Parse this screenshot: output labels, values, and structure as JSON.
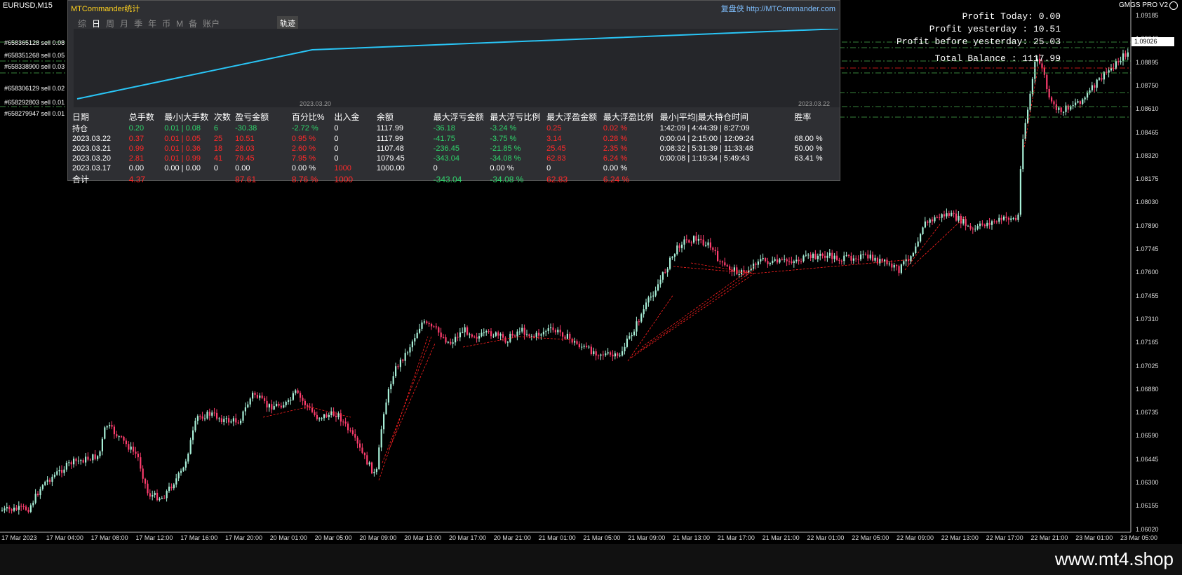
{
  "chart": {
    "symbol": "EURUSD,M15",
    "indicator_name": "GMGS PRO V2",
    "current_price": "1.09026",
    "price_ticks": [
      "1.09185",
      "1.09040",
      "1.08895",
      "1.08750",
      "1.08610",
      "1.08465",
      "1.08320",
      "1.08175",
      "1.08030",
      "1.07890",
      "1.07745",
      "1.07600",
      "1.07455",
      "1.07310",
      "1.07165",
      "1.07025",
      "1.06880",
      "1.06735",
      "1.06590",
      "1.06445",
      "1.06300",
      "1.06155",
      "1.06020"
    ],
    "time_ticks": [
      "17 Mar 2023",
      "17 Mar 04:00",
      "17 Mar 08:00",
      "17 Mar 12:00",
      "17 Mar 16:00",
      "17 Mar 20:00",
      "20 Mar 01:00",
      "20 Mar 05:00",
      "20 Mar 09:00",
      "20 Mar 13:00",
      "20 Mar 17:00",
      "20 Mar 21:00",
      "21 Mar 01:00",
      "21 Mar 05:00",
      "21 Mar 09:00",
      "21 Mar 13:00",
      "21 Mar 17:00",
      "21 Mar 21:00",
      "22 Mar 01:00",
      "22 Mar 05:00",
      "22 Mar 09:00",
      "22 Mar 13:00",
      "22 Mar 17:00",
      "22 Mar 21:00",
      "23 Mar 01:00",
      "23 Mar 05:00"
    ],
    "orders": [
      "#658365128 sell 0.08",
      "#658351268 sell 0.05",
      "#658338900 sell 0.03",
      "#658306129 sell 0.02",
      "#658292803 sell 0.01",
      "#658279947 sell 0.01"
    ],
    "profit": {
      "today": "Profit Today: 0.00",
      "yesterday": "Profit yesterday : 10.51",
      "before_yesterday": "Profit before yesterday: 25.03",
      "balance": "Total Balance : 1117.99"
    },
    "colors": {
      "bull": "#a8f0d8",
      "bear": "#ff3d6e",
      "grid_green": "#4caf50",
      "order_line": "#ff2020",
      "equity": "#29c5f6"
    }
  },
  "panel": {
    "title": "MTCommander统计",
    "site": "复盘侠 http://MTCommander.com",
    "tabs": [
      "综",
      "日",
      "周",
      "月",
      "季",
      "年",
      "币",
      "M",
      "备",
      "账户"
    ],
    "active_tab": "日",
    "track_button": "轨迹",
    "graph_date_left": "2023.03.20",
    "graph_date_right": "2023.03.22",
    "headers": [
      "日期",
      "总手数",
      "最小|大手数",
      "次数",
      "盈亏金额",
      "百分比%",
      "出入金",
      "余额",
      "最大浮亏金额",
      "最大浮亏比例",
      "最大浮盈金额",
      "最大浮盈比例",
      "最小|平均|最大持仓时间",
      "胜率"
    ],
    "rows": [
      [
        "持仓",
        "0.20",
        "0.01 | 0.08",
        "6",
        "-30.38",
        "-2.72 %",
        "0",
        "1117.99",
        "-36.18",
        "-3.24 %",
        "0.25",
        "0.02 %",
        "1:42:09 | 4:44:39 | 8:27:09",
        ""
      ],
      [
        "2023.03.22",
        "0.37",
        "0.01 | 0.05",
        "25",
        "10.51",
        "0.95 %",
        "0",
        "1117.99",
        "-41.75",
        "-3.75 %",
        "3.14",
        "0.28 %",
        "0:00:04 | 2:15:00 | 12:09:24",
        "68.00 %"
      ],
      [
        "2023.03.21",
        "0.99",
        "0.01 | 0.36",
        "18",
        "28.03",
        "2.60 %",
        "0",
        "1107.48",
        "-236.45",
        "-21.85 %",
        "25.45",
        "2.35 %",
        "0:08:32 | 5:31:39 | 11:33:48",
        "50.00 %"
      ],
      [
        "2023.03.20",
        "2.81",
        "0.01 | 0.99",
        "41",
        "79.45",
        "7.95 %",
        "0",
        "1079.45",
        "-343.04",
        "-34.08 %",
        "62.83",
        "6.24 %",
        "0:00:08 | 1:19:34 | 5:49:43",
        "63.41 %"
      ],
      [
        "2023.03.17",
        "0.00",
        "0.00 | 0.00",
        "0",
        "0.00",
        "0.00 %",
        "1000",
        "1000.00",
        "0",
        "0.00 %",
        "0",
        "0.00 %",
        "",
        ""
      ],
      [
        "合计",
        "4.37",
        "",
        "",
        "87.61",
        "8.76 %",
        "1000",
        "",
        "-343.04",
        "-34.08 %",
        "62.83",
        "6.24 %",
        "",
        ""
      ]
    ],
    "row_colors": [
      [
        "w",
        "g",
        "g",
        "g",
        "g",
        "g",
        "w",
        "w",
        "g",
        "g",
        "r",
        "r",
        "w",
        "w"
      ],
      [
        "w",
        "r",
        "r",
        "r",
        "r",
        "r",
        "w",
        "w",
        "g",
        "g",
        "r",
        "r",
        "w",
        "w"
      ],
      [
        "w",
        "r",
        "r",
        "r",
        "r",
        "r",
        "w",
        "w",
        "g",
        "g",
        "r",
        "r",
        "w",
        "w"
      ],
      [
        "w",
        "r",
        "r",
        "r",
        "r",
        "r",
        "w",
        "w",
        "g",
        "g",
        "r",
        "r",
        "w",
        "w"
      ],
      [
        "w",
        "w",
        "w",
        "w",
        "w",
        "w",
        "r",
        "w",
        "w",
        "w",
        "w",
        "w",
        "w",
        "w"
      ],
      [
        "w",
        "r",
        "w",
        "w",
        "r",
        "r",
        "r",
        "w",
        "g",
        "g",
        "r",
        "r",
        "w",
        "w"
      ]
    ]
  },
  "watermark": "www.mt4.shop"
}
